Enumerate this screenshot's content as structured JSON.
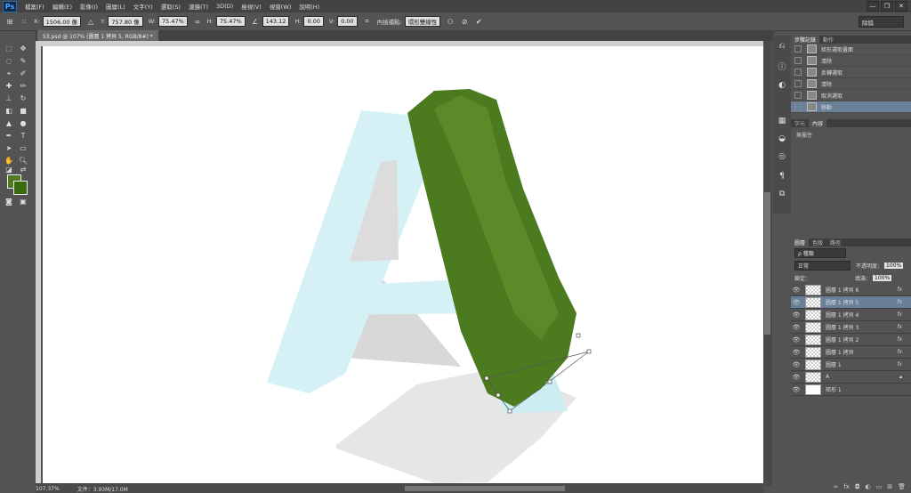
{
  "app": {
    "logo": "Ps"
  },
  "menu": [
    "檔案(F)",
    "編輯(E)",
    "影像(I)",
    "圖層(L)",
    "文字(Y)",
    "選取(S)",
    "濾鏡(T)",
    "3D(D)",
    "檢視(V)",
    "視窗(W)",
    "說明(H)"
  ],
  "window_buttons": [
    "—",
    "❐",
    "✕"
  ],
  "options": {
    "x_label": "X:",
    "x_value": "1506.00 像",
    "y_label": "Y:",
    "y_value": "757.80 像",
    "w_label": "W:",
    "w_value": "75.47%",
    "h_label": "H:",
    "h_value": "75.47%",
    "angle_value": "143.12",
    "hskew_label": "H:",
    "hskew_value": "0.00",
    "vskew_label": "V:",
    "vskew_value": "0.00",
    "interp_label": "內插補點:",
    "interp_value": "環形雙線性",
    "workspace": "除錯"
  },
  "document": {
    "tab": "53.psd @ 107% (圖層 1 拷貝 5, RGB/8#) *",
    "zoom": "107.37%",
    "file_info": "文件：3.93M/17.0M"
  },
  "history": {
    "tabs": [
      "步驟記錄",
      "動作"
    ],
    "items": [
      "矩形選取畫面",
      "清除",
      "反轉選取",
      "清除",
      "取消選取",
      "移動"
    ],
    "selected_index": 5
  },
  "character": {
    "tabs": [
      "字元",
      "內容"
    ],
    "body": "無屬性"
  },
  "layers": {
    "tabs": [
      "圖層",
      "色版",
      "路徑"
    ],
    "filter": "ρ 種類",
    "blend_mode": "正常",
    "opacity_label": "不透明度：",
    "opacity": "100%",
    "lock_label": "鎖定：",
    "fill_label": "填滿：",
    "fill": "100%",
    "items": [
      {
        "name": "圖層 1 拷貝 6",
        "fx": "fx"
      },
      {
        "name": "圖層 1 拷貝 5",
        "fx": "fx"
      },
      {
        "name": "圖層 1 拷貝 4",
        "fx": "fx"
      },
      {
        "name": "圖層 1 拷貝 3",
        "fx": "fx"
      },
      {
        "name": "圖層 1 拷貝 2",
        "fx": "fx"
      },
      {
        "name": "圖層 1 拷貝",
        "fx": "fx"
      },
      {
        "name": "圖層 1",
        "fx": "fx"
      },
      {
        "name": "A",
        "fx": ""
      },
      {
        "name": "矩形 1",
        "fx": ""
      }
    ],
    "selected_index": 1
  },
  "colors": {
    "foreground": "#4e7a20",
    "background": "#3a6a10",
    "selection": "#6a7f98"
  }
}
